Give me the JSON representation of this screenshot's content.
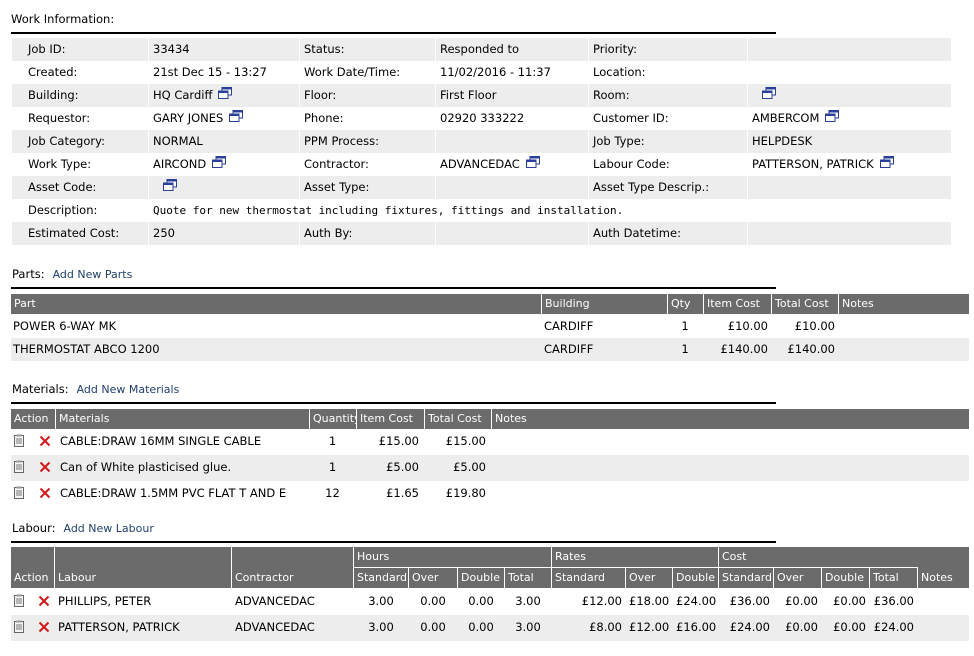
{
  "work_info": {
    "title": "Work Information:",
    "rows": [
      [
        {
          "l": "Job ID:",
          "v": "33434"
        },
        {
          "l": "Status:",
          "v": "Responded to"
        },
        {
          "l": "Priority:",
          "v": ""
        }
      ],
      [
        {
          "l": "Created:",
          "v": "21st Dec 15  -  13:27"
        },
        {
          "l": "Work Date/Time:",
          "v": "11/02/2016  -  11:37"
        },
        {
          "l": "Location:",
          "v": ""
        }
      ],
      [
        {
          "l": "Building:",
          "v": "HQ Cardiff"
        },
        {
          "l": "Floor:",
          "v": "First Floor"
        },
        {
          "l": "Room:",
          "v": ""
        }
      ],
      [
        {
          "l": "Requestor:",
          "v": "GARY JONES"
        },
        {
          "l": "Phone:",
          "v": "02920 333222"
        },
        {
          "l": "Customer ID:",
          "v": "AMBERCOM"
        }
      ],
      [
        {
          "l": "Job Category:",
          "v": "NORMAL"
        },
        {
          "l": "PPM Process:",
          "v": ""
        },
        {
          "l": "Job Type:",
          "v": "HELPDESK"
        }
      ],
      [
        {
          "l": "Work Type:",
          "v": "AIRCOND"
        },
        {
          "l": "Contractor:",
          "v": "ADVANCEDAC"
        },
        {
          "l": "Labour Code:",
          "v": "PATTERSON, PATRICK"
        }
      ],
      [
        {
          "l": "Asset Code:",
          "v": ""
        },
        {
          "l": "Asset Type:",
          "v": ""
        },
        {
          "l": "Asset Type Descrip.:",
          "v": ""
        }
      ],
      [
        {
          "l": "Description:",
          "v": "Quote for new thermostat including fixtures, fittings and installation."
        }
      ],
      [
        {
          "l": "Estimated Cost:",
          "v": "250"
        },
        {
          "l": "Auth By:",
          "v": ""
        },
        {
          "l": "Auth Datetime:",
          "v": ""
        }
      ]
    ]
  },
  "parts": {
    "title": "Parts:",
    "add_link": "Add New Parts",
    "headers": [
      "Part",
      "Building",
      "Qty",
      "Item Cost",
      "Total Cost",
      "Notes"
    ],
    "rows": [
      [
        "POWER 6-WAY MK",
        "CARDIFF",
        "1",
        "£10.00",
        "£10.00",
        ""
      ],
      [
        "THERMOSTAT ABCO 1200",
        "CARDIFF",
        "1",
        "£140.00",
        "£140.00",
        ""
      ]
    ]
  },
  "materials": {
    "title": "Materials:",
    "add_link": "Add New Materials",
    "headers": [
      "Action",
      "Materials",
      "Quantity",
      "Item Cost",
      "Total Cost",
      "Notes"
    ],
    "rows": [
      [
        "CABLE:DRAW 16MM SINGLE CABLE",
        "1",
        "£15.00",
        "£15.00",
        ""
      ],
      [
        "Can of White plasticised glue.",
        "1",
        "£5.00",
        "£5.00",
        ""
      ],
      [
        "CABLE:DRAW 1.5MM PVC FLAT T AND E",
        "12",
        "£1.65",
        "£19.80",
        ""
      ]
    ]
  },
  "labour": {
    "title": "Labour:",
    "add_link": "Add New Labour",
    "groups": [
      "Hours",
      "Rates",
      "Cost"
    ],
    "headers": [
      "Action",
      "Labour",
      "Contractor",
      "Standard",
      "Over",
      "Double",
      "Total",
      "Standard",
      "Over",
      "Double",
      "Standard",
      "Over",
      "Double",
      "Total",
      "Notes"
    ],
    "rows": [
      [
        "PHILLIPS, PETER",
        "ADVANCEDAC",
        "3.00",
        "0.00",
        "0.00",
        "3.00",
        "£12.00",
        "£18.00",
        "£24.00",
        "£36.00",
        "£0.00",
        "£0.00",
        "£36.00",
        ""
      ],
      [
        "PATTERSON, PATRICK",
        "ADVANCEDAC",
        "3.00",
        "0.00",
        "0.00",
        "3.00",
        "£8.00",
        "£12.00",
        "£16.00",
        "£24.00",
        "£0.00",
        "£0.00",
        "£24.00",
        ""
      ]
    ]
  },
  "icons": {
    "edit": "notepad-icon",
    "delete": "delete-x-icon",
    "popup": "popup-window-icon"
  }
}
